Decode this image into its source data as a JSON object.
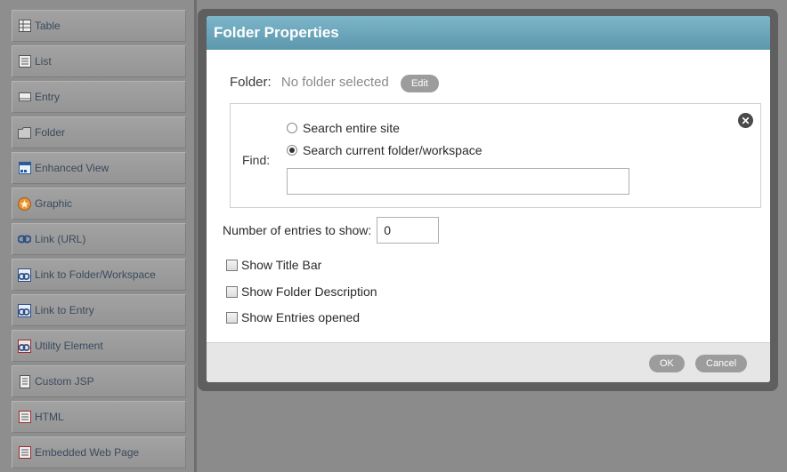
{
  "palette": {
    "items": [
      {
        "label": "Table",
        "icon": "table-icon"
      },
      {
        "label": "List",
        "icon": "list-icon"
      },
      {
        "label": "Entry",
        "icon": "entry-icon"
      },
      {
        "label": "Folder",
        "icon": "folder-icon"
      },
      {
        "label": "Enhanced View",
        "icon": "enhanced-view-icon"
      },
      {
        "label": "Graphic",
        "icon": "graphic-icon"
      },
      {
        "label": "Link (URL)",
        "icon": "link-icon"
      },
      {
        "label": "Link to Folder/Workspace",
        "icon": "link-folder-icon"
      },
      {
        "label": "Link to Entry",
        "icon": "link-entry-icon"
      },
      {
        "label": "Utility Element",
        "icon": "utility-icon"
      },
      {
        "label": "Custom JSP",
        "icon": "custom-jsp-icon"
      },
      {
        "label": "HTML",
        "icon": "html-icon"
      },
      {
        "label": "Embedded Web Page",
        "icon": "embedded-page-icon"
      }
    ]
  },
  "dialog": {
    "title": "Folder Properties",
    "folder_label": "Folder:",
    "folder_value": "No folder selected",
    "edit_label": "Edit",
    "find_label": "Find:",
    "radio_site": "Search entire site",
    "radio_folder": "Search current folder/workspace",
    "selected_radio": "folder",
    "entries_label": "Number of entries to show:",
    "entries_value": "0",
    "checkboxes": [
      {
        "label": "Show Title Bar",
        "checked": false
      },
      {
        "label": "Show Folder Description",
        "checked": false
      },
      {
        "label": "Show Entries opened",
        "checked": false
      }
    ],
    "ok_label": "OK",
    "cancel_label": "Cancel"
  },
  "colors": {
    "header": "#6aa6bb",
    "button": "#9c9c9c",
    "palette_text": "#3a4a5c"
  }
}
